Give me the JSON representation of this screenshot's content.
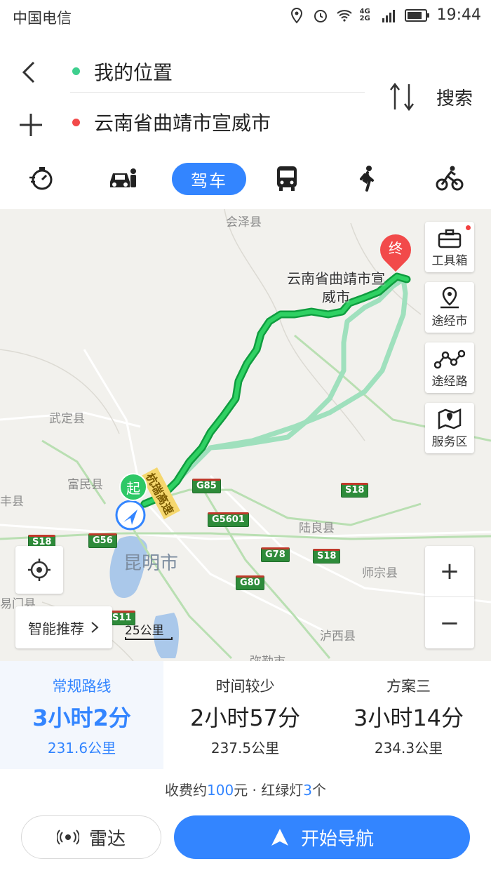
{
  "status_bar": {
    "carrier": "中国电信",
    "net": "4G 2G",
    "time": "19:44",
    "icons": [
      "location-icon",
      "alarm-icon",
      "wifi-icon",
      "signal-icon",
      "battery-icon"
    ]
  },
  "header": {
    "from": "我的位置",
    "to": "云南省曲靖市宣威市",
    "search_label": "搜索",
    "from_dot_color": "#3ecf8e",
    "to_dot_color": "#f24a4a"
  },
  "modes": {
    "active_label": "驾车",
    "icons": [
      "stopwatch-icon",
      "taxi-icon",
      "car-icon",
      "bus-icon",
      "walk-icon",
      "bicycle-icon"
    ]
  },
  "map": {
    "labels": {
      "huize": "会泽县",
      "wuding": "武定县",
      "fumin": "富民县",
      "feng": "丰县",
      "yimen": "易门县",
      "luliang": "陆良县",
      "shizong": "师宗县",
      "luxi": "泸西县",
      "mile": "弥勒市",
      "kunming": "昆明市",
      "highway_name": "杭瑞高速"
    },
    "destination_label": "云南省曲靖市宣威市",
    "start_pin": "起",
    "end_pin": "终",
    "shields": {
      "g85": "G85",
      "s18a": "S18",
      "g5601": "G5601",
      "s18b": "S18",
      "g56": "G56",
      "g78": "G78",
      "s18c": "S18",
      "g80": "G80",
      "s11": "S11"
    },
    "tools": [
      {
        "label": "工具箱",
        "icon": "toolbox-icon"
      },
      {
        "label": "途经市",
        "icon": "location-pin-icon"
      },
      {
        "label": "途经路",
        "icon": "route-nodes-icon"
      },
      {
        "label": "服务区",
        "icon": "map-service-icon"
      }
    ],
    "smart_recommend": "智能推荐",
    "scale_label": "25公里",
    "zoom_in": "+",
    "zoom_out": "−"
  },
  "routes": [
    {
      "name": "常规路线",
      "time": "3小时2分",
      "distance": "231.6公里"
    },
    {
      "name": "时间较少",
      "time": "2小时57分",
      "distance": "237.5公里"
    },
    {
      "name": "方案三",
      "time": "3小时14分",
      "distance": "234.3公里"
    }
  ],
  "info": {
    "toll_prefix": "收费约",
    "toll_amount": "100",
    "toll_suffix": "元 · 红绿灯",
    "lights": "3",
    "lights_suffix": "个"
  },
  "actions": {
    "radar": "雷达",
    "navigate": "开始导航"
  },
  "colors": {
    "accent": "#3385ff",
    "route_main": "#1db954",
    "route_alt": "#a8e6c1"
  }
}
